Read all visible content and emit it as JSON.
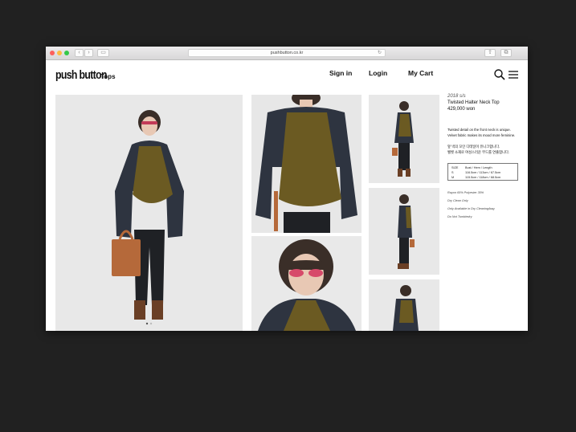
{
  "browser": {
    "url": "pushbutton.co.kr"
  },
  "site": {
    "logo": "push button",
    "category": "Tops",
    "nav": [
      "Sign in",
      "Login",
      "My Cart"
    ]
  },
  "product": {
    "season": "2018 s/s",
    "name": "Twisted Halter Neck Top",
    "price": "429,000 won",
    "description_en": [
      "Twisted detail on the front neck is unique.",
      "Velvet fabric makes its mood more feminine."
    ],
    "description_ko": [
      "앞 넥의 꼬인 디테일이 유니크합니다.",
      "벨벳 소재로 여성스러운 무드를 연출합니다."
    ],
    "size_table": {
      "headers": [
        "SIZE",
        "Bust / Hem / Length"
      ],
      "rows": [
        [
          "S",
          "116.5cm / 113cm / 67.5cm"
        ],
        [
          "M",
          "115.5cm / 118cm / 68.5cm"
        ]
      ]
    },
    "notes": [
      "Rayon 65% Polyester 35%",
      "Dry Clean Only",
      "Only Available in Dry Cleaning/bag",
      "Do Not Tumbledry"
    ]
  },
  "colors": {
    "background": "#212121",
    "page": "#ffffff",
    "jacket": "#2e3440",
    "velvet_top": "#6b5a22",
    "bag": "#b5693a"
  },
  "icons": {
    "search": "search-icon",
    "menu": "hamburger-menu-icon"
  }
}
